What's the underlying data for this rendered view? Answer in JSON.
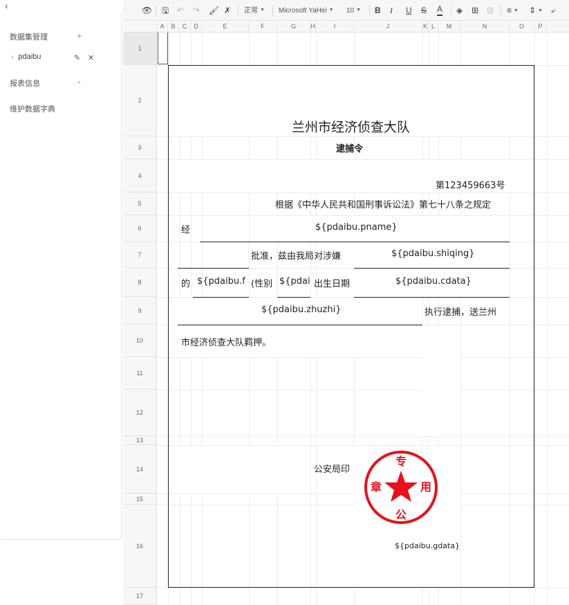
{
  "left_panel": {
    "back_icon": "chevron-left-icon",
    "dataset_title": "数据集管理",
    "add_glyph": "+",
    "dataset_item": "pdaibu",
    "report_title": "报表信息",
    "dictionary_title": "维护数据字典"
  },
  "toolbar": {
    "style_select": "正常",
    "font_select": "Microsoft YaHei",
    "size_select": "10",
    "bold": "B",
    "italic": "I",
    "underline": "U",
    "strike": "S",
    "font_color": "A"
  },
  "columns": [
    "A",
    "B",
    "C",
    "D",
    "E",
    "F",
    "G",
    "H",
    "I",
    "J",
    "K",
    "L",
    "M",
    "N",
    "O",
    "P"
  ],
  "rows": [
    "1",
    "2",
    "3",
    "4",
    "5",
    "6",
    "7",
    "8",
    "9",
    "10",
    "11",
    "12",
    "13",
    "14",
    "15",
    "16",
    "17"
  ],
  "document": {
    "title": "兰州市经济侦查大队",
    "subtitle": "逮捕令",
    "number": "第123459663号",
    "basis": "根据《中华人民共和国刑事诉讼法》第七十八条之规定",
    "via": "经",
    "pname": "${pdaibu.pname}",
    "approved": "批准，兹由我局对涉嫌",
    "shiqing": "${pdaibu.shiqing}",
    "of": "的",
    "f_field": "${pdaibu.f",
    "gender": "(性别",
    "pdai": "${pdai",
    "birth": "出生日期",
    "cdata": "${pdaibu.cdata}",
    "zhuzhi": "${pdaibu.zhuzhi}",
    "execute": "执行逮捕，送兰州",
    "detain": "市经济侦查大队羁押。",
    "seal_label": "公安局印",
    "gdata": "${pdaibu.gdata}"
  },
  "stamp": {
    "top": "专",
    "left": "章",
    "right": "用",
    "bottom": "公",
    "color": "#e8101b"
  }
}
